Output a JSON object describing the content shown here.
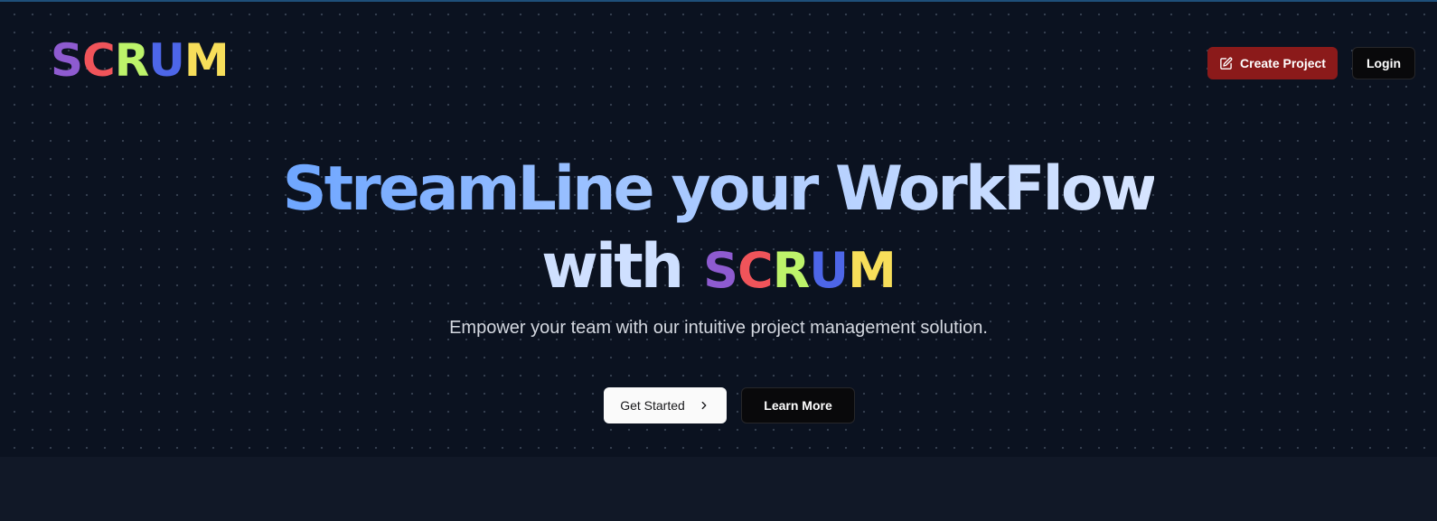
{
  "header": {
    "logo": {
      "letters": [
        "S",
        "C",
        "R",
        "U",
        "M"
      ],
      "colors": [
        "#8e5bd0",
        "#f0545a",
        "#bdf36a",
        "#4d66e8",
        "#f7de5a"
      ]
    },
    "create_project_label": "Create Project",
    "create_project_icon": "edit-icon",
    "login_label": "Login"
  },
  "hero": {
    "headline_line1": "StreamLine your WorkFlow",
    "headline_with": "with",
    "tagline": "Empower your team with our intuitive project management solution.",
    "get_started_label": "Get Started",
    "get_started_icon": "chevron-right-icon",
    "learn_more_label": "Learn More"
  },
  "colors": {
    "background": "#0b1220",
    "accent_red": "#8b1a1a",
    "headline_gradient": [
      "#6ea6ff",
      "#d7e5ff"
    ]
  }
}
